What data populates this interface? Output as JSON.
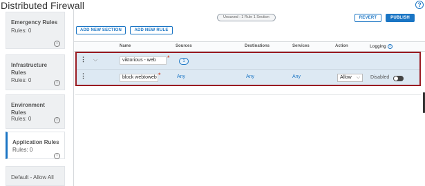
{
  "title": "Distributed Firewall",
  "help_symbol": "?",
  "categories": [
    {
      "name": "Emergency Rules",
      "rules": "Rules: 0"
    },
    {
      "name": "Infrastructure Rules",
      "rules": "Rules: 0"
    },
    {
      "name": "Environment Rules",
      "rules": "Rules: 0"
    },
    {
      "name": "Application Rules",
      "rules": "Rules: 0"
    },
    {
      "name": "Default - Allow All"
    }
  ],
  "info_symbol": "i",
  "toolbar": {
    "unsaved": "Unsaved : 1 Rule 1 Section",
    "revert": "REVERT",
    "publish": "PUBLISH",
    "add_section": "ADD NEW SECTION",
    "add_rule": "ADD NEW RULE"
  },
  "columns": {
    "name": "Name",
    "sources": "Sources",
    "destinations": "Destinations",
    "services": "Services",
    "action": "Action",
    "logging": "Logging"
  },
  "section": {
    "name": "viktorious - web",
    "rule_count": "1"
  },
  "rule": {
    "name": "block webtoweb",
    "sources": "Any",
    "destinations": "Any",
    "services": "Any",
    "action": "Allow",
    "logging": "Disabled"
  },
  "colors": {
    "accent": "#1a75c4",
    "highlight_border": "#9a1b22",
    "row_background": "#dde9f3"
  }
}
